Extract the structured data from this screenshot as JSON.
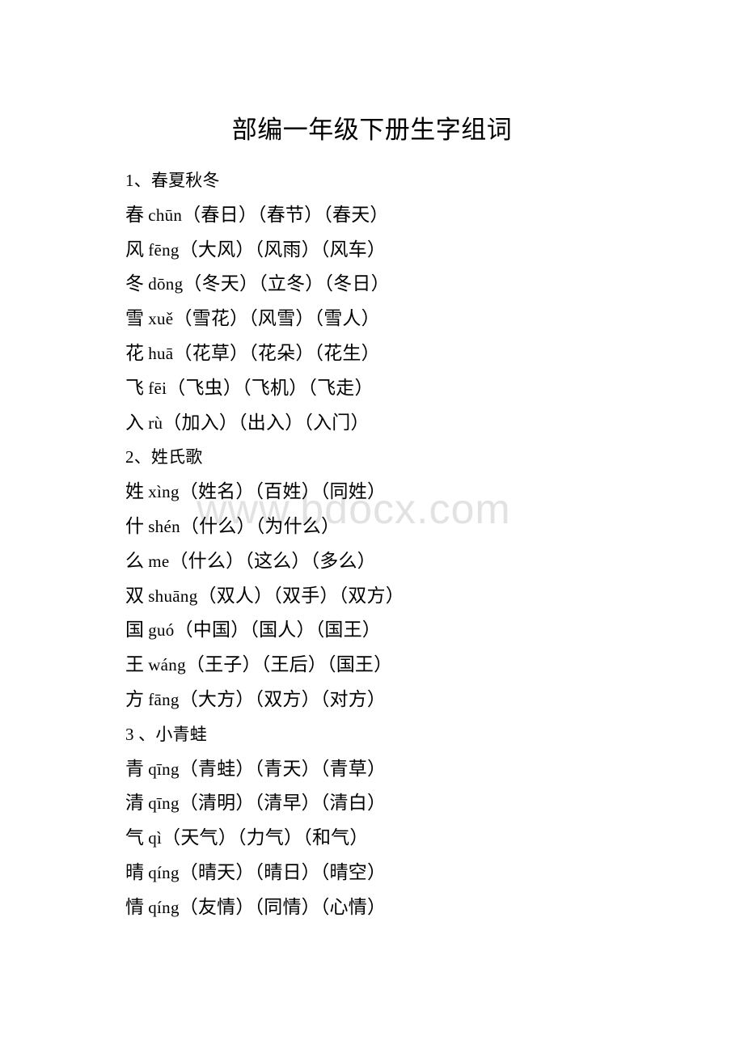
{
  "document": {
    "title": "部编一年级下册生字组词",
    "watermark": "www.bdocx.com"
  },
  "sections": [
    {
      "heading": "1、春夏秋冬",
      "entries": [
        {
          "character": "春",
          "pinyin": "chūn",
          "words": "（春日）（春节）（春天）"
        },
        {
          "character": "风",
          "pinyin": "fēng",
          "words": "（大风）（风雨）（风车）"
        },
        {
          "character": "冬",
          "pinyin": "dōng",
          "words": "（冬天）（立冬）（冬日）"
        },
        {
          "character": "雪",
          "pinyin": "xuě",
          "words": "（雪花）（风雪）（雪人）"
        },
        {
          "character": "花",
          "pinyin": "huā",
          "words": "（花草）（花朵）（花生）"
        },
        {
          "character": "飞",
          "pinyin": "fēi",
          "words": "（飞虫）（飞机）（飞走）"
        },
        {
          "character": "入",
          "pinyin": "rù",
          "words": "（加入）（出入）（入门）"
        }
      ]
    },
    {
      "heading": "2、姓氏歌",
      "entries": [
        {
          "character": "姓",
          "pinyin": "xìng",
          "words": "（姓名）（百姓）（同姓）"
        },
        {
          "character": "什",
          "pinyin": "shén",
          "words": "（什么）（为什么）"
        },
        {
          "character": "么",
          "pinyin": "me",
          "words": "（什么）（这么）（多么）"
        },
        {
          "character": "双",
          "pinyin": "shuāng",
          "words": "（双人）（双手）（双方）"
        },
        {
          "character": "国",
          "pinyin": "guó",
          "words": "（中国）（国人）（国王）"
        },
        {
          "character": "王",
          "pinyin": "wáng",
          "words": "（王子）（王后）（国王）"
        },
        {
          "character": "方",
          "pinyin": "fāng",
          "words": "（大方）（双方）（对方）"
        }
      ]
    },
    {
      "heading": "3 、小青蛙",
      "entries": [
        {
          "character": "青",
          "pinyin": "qīng",
          "words": "（青蛙）（青天）（青草）"
        },
        {
          "character": "清",
          "pinyin": "qīng",
          "words": "（清明）（清早）（清白）"
        },
        {
          "character": "气",
          "pinyin": "qì",
          "words": "（天气）（力气）（和气）"
        },
        {
          "character": "晴",
          "pinyin": "qíng",
          "words": "（晴天）（晴日）（晴空）"
        },
        {
          "character": "情",
          "pinyin": "qíng",
          "words": "（友情）（同情）（心情）"
        }
      ]
    }
  ]
}
